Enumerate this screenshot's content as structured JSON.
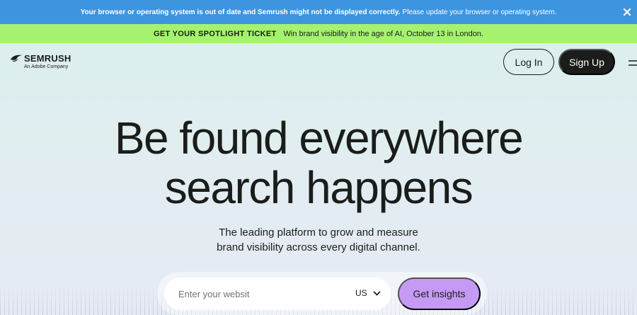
{
  "browser_warning": {
    "strong_text": "Your browser or operating system is out of date and Semrush might not be displayed correctly.",
    "text": "Please update your browser or operating system.",
    "close_icon": "close-icon"
  },
  "promo": {
    "tag": "GET YOUR SPOTLIGHT TICKET",
    "text": "Win brand visibility in the age of AI, October 13 in London."
  },
  "header": {
    "logo_word": "SEMRUSH",
    "logo_sub": "An Adobe Company",
    "login_label": "Log In",
    "signup_label": "Sign Up",
    "menu_icon": "hamburger-menu-icon"
  },
  "hero": {
    "title_line1": "Be found everywhere",
    "title_line2": "search happens",
    "subtitle_line1": "The leading platform to grow and measure",
    "subtitle_line2": "brand visibility across every digital channel."
  },
  "search": {
    "placeholder": "Enter your websit",
    "value": "",
    "country": "US",
    "cta_label": "Get insights"
  },
  "colors": {
    "warning_bg": "#3d95e0",
    "promo_bg": "#a5f26f",
    "dark": "#1b1d1a",
    "cta_bg": "#c59af5"
  }
}
